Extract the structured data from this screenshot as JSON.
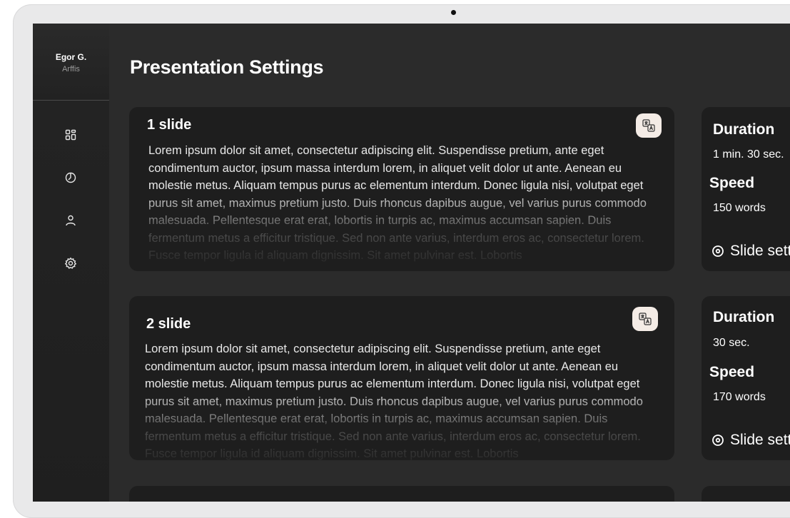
{
  "user": {
    "name": "Egor G.",
    "org": "Arffis"
  },
  "nav": [
    {
      "icon": "dashboard-icon"
    },
    {
      "icon": "timer-icon"
    },
    {
      "icon": "user-icon"
    },
    {
      "icon": "gear-icon"
    }
  ],
  "page_title": "Presentation Settings",
  "slides": [
    {
      "title": "1 slide",
      "text": "Lorem ipsum dolor sit amet, consectetur adipiscing elit. Suspendisse pretium, ante eget condimentum auctor, ipsum massa interdum lorem, in aliquet velit dolor ut ante. Aenean eu molestie metus. Aliquam tempus purus ac elementum interdum. Donec ligula nisi, volutpat eget purus sit amet, maximus pretium justo. Duis rhoncus dapibus augue, vel varius purus commodo malesuada. Pellentesque erat erat, lobortis in turpis ac, maximus accumsan sapien. Duis fermentum metus a efficitur tristique. Sed non ante varius, interdum eros ac, consectetur lorem. Fusce tempor ligula id aliquam dignissim. Sit amet pulvinar est. Lobortis",
      "duration_label": "Duration",
      "duration_value": "1 min. 30 sec.",
      "speed_label": "Speed",
      "speed_value": "150 words",
      "settings_label": "Slide settings"
    },
    {
      "title": "2 slide",
      "text": "Lorem ipsum dolor sit amet, consectetur adipiscing elit. Suspendisse pretium, ante eget condimentum auctor, ipsum massa interdum lorem, in aliquet velit dolor ut ante. Aenean eu molestie metus. Aliquam tempus purus ac elementum interdum. Donec ligula nisi, volutpat eget purus sit amet, maximus pretium justo. Duis rhoncus dapibus augue, vel varius purus commodo malesuada. Pellentesque erat erat, lobortis in turpis ac, maximus accumsan sapien. Duis fermentum metus a efficitur tristique. Sed non ante varius, interdum eros ac, consectetur lorem. Fusce tempor ligula id aliquam dignissim. Sit amet pulvinar est. Lobortis",
      "duration_label": "Duration",
      "duration_value": "30 sec.",
      "speed_label": "Speed",
      "speed_value": "170 words",
      "settings_label": "Slide settings"
    }
  ],
  "colors": {
    "background": "#2b2b2b",
    "card": "#1e1e1e",
    "translate_button": "#f4ece6"
  }
}
